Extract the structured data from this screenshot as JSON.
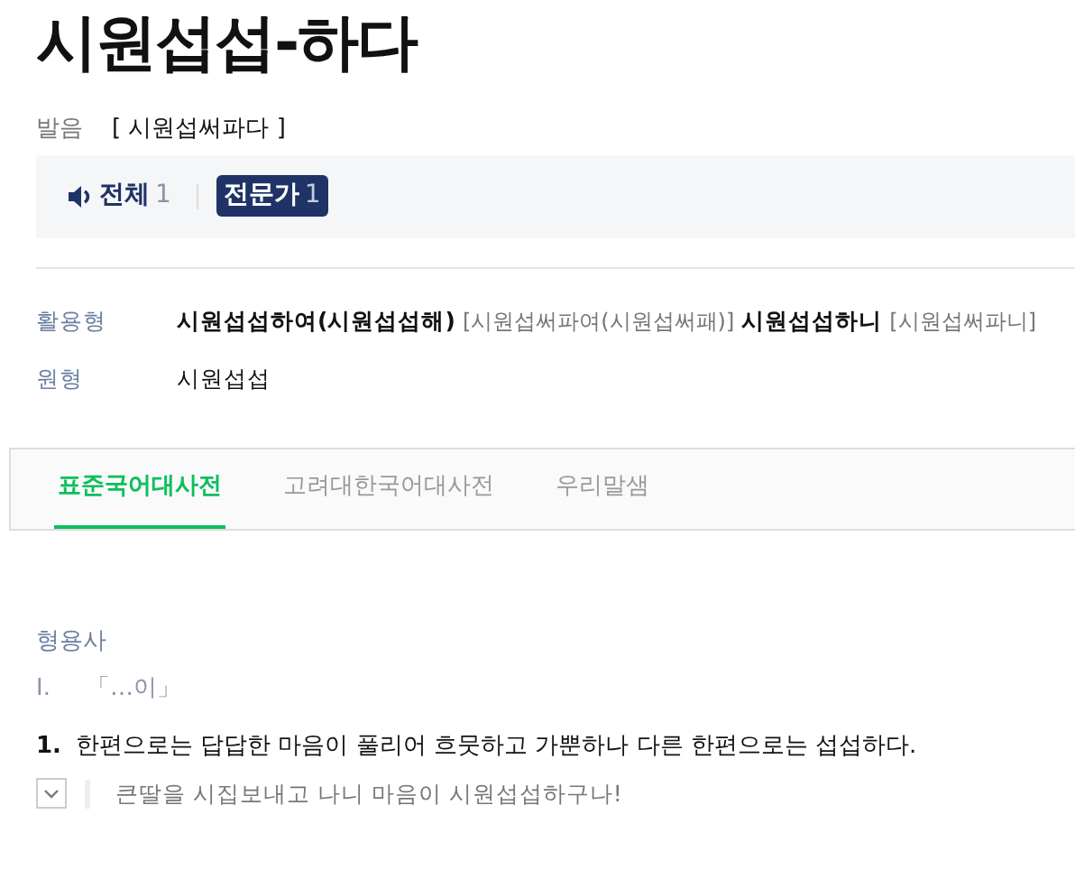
{
  "title": "시원섭섭-하다",
  "pronunciation": {
    "label": "발음",
    "text": "[ 시원섭써파다 ]"
  },
  "audio_filters": [
    {
      "label": "전체",
      "count": "1",
      "selected": false,
      "kind": "speaker"
    },
    {
      "label": "전문가",
      "count": "1",
      "selected": true,
      "kind": "plain"
    }
  ],
  "forms": [
    {
      "label": "활용형",
      "parts": [
        {
          "text": "시원섭섭하여(시원섭섭해)",
          "kind": "form"
        },
        {
          "text": "[시원섭써파여(시원섭써패)]",
          "kind": "pron"
        },
        {
          "text": "시원섭섭하니",
          "kind": "form"
        },
        {
          "text": "[시원섭써파니]",
          "kind": "pron"
        }
      ]
    },
    {
      "label": "원형",
      "parts": [
        {
          "text": "시원섭섭",
          "kind": "plain"
        }
      ]
    }
  ],
  "tabs": [
    {
      "label": "표준국어대사전",
      "selected": true
    },
    {
      "label": "고려대한국어대사전",
      "selected": false
    },
    {
      "label": "우리말샘",
      "selected": false
    }
  ],
  "definition": {
    "part_of_speech": "형용사",
    "group": {
      "marker": "I.",
      "text": "「…이」"
    },
    "senses": [
      {
        "number": "1.",
        "text": "한편으로는 답답한 마음이 풀리어 흐뭇하고 가뿐하나 다른 한편으로는 섭섭하다.",
        "example": "큰딸을 시집보내고 나니 마음이 시원섭섭하구나!"
      }
    ]
  }
}
